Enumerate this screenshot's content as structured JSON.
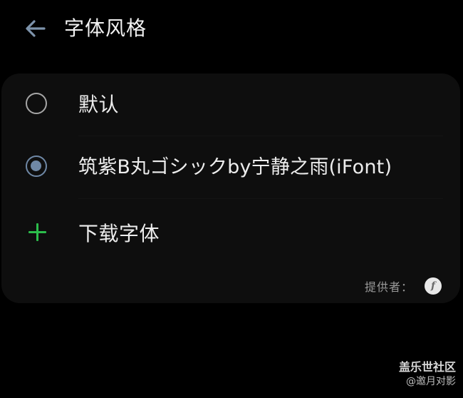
{
  "header": {
    "back_icon": "arrow-left-icon",
    "title": "字体风格"
  },
  "colors": {
    "background": "#000000",
    "card": "#0e0e0e",
    "accent": "#6f88a6",
    "plus": "#2bbd4b"
  },
  "options": [
    {
      "label": "默认",
      "selected": false,
      "icon": "radio-unchecked-icon"
    },
    {
      "label": "筑紫B丸ゴシックby宁静之雨(iFont)",
      "selected": true,
      "icon": "radio-checked-icon"
    },
    {
      "label": "下载字体",
      "icon": "plus-icon"
    }
  ],
  "provider": {
    "label": "提供者：",
    "logo_icon": "ifont-logo-icon",
    "logo_text": "f"
  },
  "watermark": {
    "title": "盖乐世社区",
    "user": "@邀月对影"
  }
}
